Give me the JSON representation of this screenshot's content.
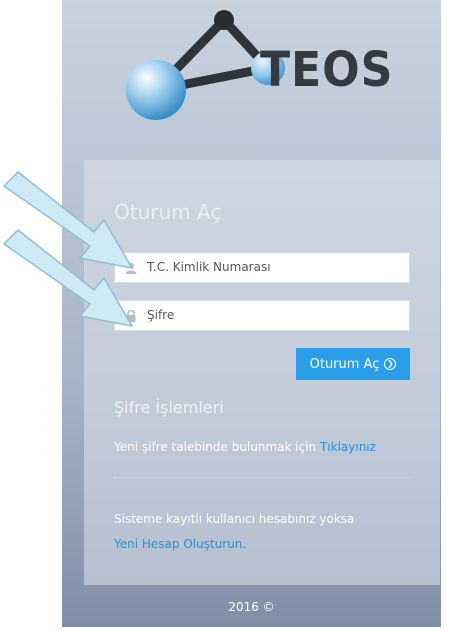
{
  "brand": {
    "name": "TEOS"
  },
  "login": {
    "title": "Oturum Aç",
    "id_placeholder": "T.C. Kimlik Numarası",
    "password_placeholder": "Şifre",
    "submit_label": "Oturum Aç"
  },
  "password_ops": {
    "title": "Şifre İşlemleri",
    "reset_text": "Yeni şifre talebinde bulunmak için ",
    "reset_link": "Tıklayınız"
  },
  "register": {
    "text": "Sisteme kayıtlı kullanıcı hesabınız yoksa",
    "link": "Yeni Hesap Oluşturun."
  },
  "footer": {
    "text": "2016 ©"
  },
  "colors": {
    "accent": "#2a9ee8",
    "link": "#2b8fd6",
    "arrow": "#cfeaf4"
  },
  "icons": [
    "molecule-logo-icon",
    "user-icon",
    "lock-icon",
    "arrow-circle-right-icon",
    "pointer-arrow-icon"
  ]
}
